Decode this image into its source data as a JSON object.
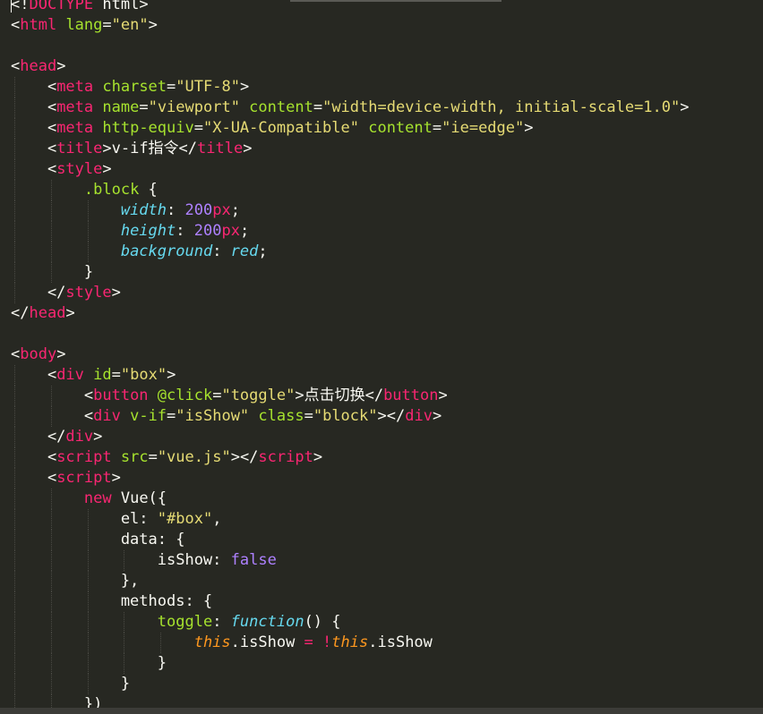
{
  "editor": {
    "lines": [
      [
        {
          "t": "<!",
          "c": "plain"
        },
        {
          "t": "DOCTYPE",
          "c": "tag"
        },
        {
          "t": " html>",
          "c": "plain"
        }
      ],
      [
        {
          "t": "<",
          "c": "plain"
        },
        {
          "t": "html",
          "c": "tag"
        },
        {
          "t": " lang",
          "c": "attr"
        },
        {
          "t": "=",
          "c": "plain"
        },
        {
          "t": "\"en\"",
          "c": "str"
        },
        {
          "t": ">",
          "c": "plain"
        }
      ],
      [],
      [
        {
          "t": "<",
          "c": "plain"
        },
        {
          "t": "head",
          "c": "tag"
        },
        {
          "t": ">",
          "c": "plain"
        }
      ],
      [
        {
          "t": "    <",
          "c": "plain"
        },
        {
          "t": "meta",
          "c": "tag"
        },
        {
          "t": " charset",
          "c": "attr"
        },
        {
          "t": "=",
          "c": "plain"
        },
        {
          "t": "\"UTF-8\"",
          "c": "str"
        },
        {
          "t": ">",
          "c": "plain"
        }
      ],
      [
        {
          "t": "    <",
          "c": "plain"
        },
        {
          "t": "meta",
          "c": "tag"
        },
        {
          "t": " name",
          "c": "attr"
        },
        {
          "t": "=",
          "c": "plain"
        },
        {
          "t": "\"viewport\"",
          "c": "str"
        },
        {
          "t": " content",
          "c": "attr"
        },
        {
          "t": "=",
          "c": "plain"
        },
        {
          "t": "\"width=device-width, initial-scale=1.0\"",
          "c": "str"
        },
        {
          "t": ">",
          "c": "plain"
        }
      ],
      [
        {
          "t": "    <",
          "c": "plain"
        },
        {
          "t": "meta",
          "c": "tag"
        },
        {
          "t": " http-equiv",
          "c": "attr"
        },
        {
          "t": "=",
          "c": "plain"
        },
        {
          "t": "\"X-UA-Compatible\"",
          "c": "str"
        },
        {
          "t": " content",
          "c": "attr"
        },
        {
          "t": "=",
          "c": "plain"
        },
        {
          "t": "\"ie=edge\"",
          "c": "str"
        },
        {
          "t": ">",
          "c": "plain"
        }
      ],
      [
        {
          "t": "    <",
          "c": "plain"
        },
        {
          "t": "title",
          "c": "tag"
        },
        {
          "t": ">v-if指令</",
          "c": "plain"
        },
        {
          "t": "title",
          "c": "tag"
        },
        {
          "t": ">",
          "c": "plain"
        }
      ],
      [
        {
          "t": "    <",
          "c": "plain"
        },
        {
          "t": "style",
          "c": "tag"
        },
        {
          "t": ">",
          "c": "plain"
        }
      ],
      [
        {
          "t": "        ",
          "c": "plain"
        },
        {
          "t": ".block",
          "c": "attr"
        },
        {
          "t": " {",
          "c": "plain"
        }
      ],
      [
        {
          "t": "            ",
          "c": "plain"
        },
        {
          "t": "width",
          "c": "prop"
        },
        {
          "t": ": ",
          "c": "plain"
        },
        {
          "t": "200",
          "c": "num"
        },
        {
          "t": "px",
          "c": "kw"
        },
        {
          "t": ";",
          "c": "plain"
        }
      ],
      [
        {
          "t": "            ",
          "c": "plain"
        },
        {
          "t": "height",
          "c": "prop"
        },
        {
          "t": ": ",
          "c": "plain"
        },
        {
          "t": "200",
          "c": "num"
        },
        {
          "t": "px",
          "c": "kw"
        },
        {
          "t": ";",
          "c": "plain"
        }
      ],
      [
        {
          "t": "            ",
          "c": "plain"
        },
        {
          "t": "background",
          "c": "prop"
        },
        {
          "t": ": ",
          "c": "plain"
        },
        {
          "t": "red",
          "c": "func"
        },
        {
          "t": ";",
          "c": "plain"
        }
      ],
      [
        {
          "t": "        }",
          "c": "plain"
        }
      ],
      [
        {
          "t": "    </",
          "c": "plain"
        },
        {
          "t": "style",
          "c": "tag"
        },
        {
          "t": ">",
          "c": "plain"
        }
      ],
      [
        {
          "t": "</",
          "c": "plain"
        },
        {
          "t": "head",
          "c": "tag"
        },
        {
          "t": ">",
          "c": "plain"
        }
      ],
      [],
      [
        {
          "t": "<",
          "c": "plain"
        },
        {
          "t": "body",
          "c": "tag"
        },
        {
          "t": ">",
          "c": "plain"
        }
      ],
      [
        {
          "t": "    <",
          "c": "plain"
        },
        {
          "t": "div",
          "c": "tag"
        },
        {
          "t": " id",
          "c": "attr"
        },
        {
          "t": "=",
          "c": "plain"
        },
        {
          "t": "\"box\"",
          "c": "str"
        },
        {
          "t": ">",
          "c": "plain"
        }
      ],
      [
        {
          "t": "        <",
          "c": "plain"
        },
        {
          "t": "button",
          "c": "tag"
        },
        {
          "t": " @click",
          "c": "attr"
        },
        {
          "t": "=",
          "c": "plain"
        },
        {
          "t": "\"toggle\"",
          "c": "str"
        },
        {
          "t": ">点击切换</",
          "c": "plain"
        },
        {
          "t": "button",
          "c": "tag"
        },
        {
          "t": ">",
          "c": "plain"
        }
      ],
      [
        {
          "t": "        <",
          "c": "plain"
        },
        {
          "t": "div",
          "c": "tag"
        },
        {
          "t": " v-if",
          "c": "attr"
        },
        {
          "t": "=",
          "c": "plain"
        },
        {
          "t": "\"isShow\"",
          "c": "str"
        },
        {
          "t": " class",
          "c": "attr"
        },
        {
          "t": "=",
          "c": "plain"
        },
        {
          "t": "\"block\"",
          "c": "str"
        },
        {
          "t": "></",
          "c": "plain"
        },
        {
          "t": "div",
          "c": "tag"
        },
        {
          "t": ">",
          "c": "plain"
        }
      ],
      [
        {
          "t": "    </",
          "c": "plain"
        },
        {
          "t": "div",
          "c": "tag"
        },
        {
          "t": ">",
          "c": "plain"
        }
      ],
      [
        {
          "t": "    <",
          "c": "plain"
        },
        {
          "t": "script",
          "c": "tag"
        },
        {
          "t": " src",
          "c": "attr"
        },
        {
          "t": "=",
          "c": "plain"
        },
        {
          "t": "\"vue.js\"",
          "c": "str"
        },
        {
          "t": "></",
          "c": "plain"
        },
        {
          "t": "script",
          "c": "tag"
        },
        {
          "t": ">",
          "c": "plain"
        }
      ],
      [
        {
          "t": "    <",
          "c": "plain"
        },
        {
          "t": "script",
          "c": "tag"
        },
        {
          "t": ">",
          "c": "plain"
        }
      ],
      [
        {
          "t": "        ",
          "c": "plain"
        },
        {
          "t": "new",
          "c": "kw"
        },
        {
          "t": " Vue({",
          "c": "plain"
        }
      ],
      [
        {
          "t": "            el: ",
          "c": "plain"
        },
        {
          "t": "\"#box\"",
          "c": "str"
        },
        {
          "t": ",",
          "c": "plain"
        }
      ],
      [
        {
          "t": "            data: {",
          "c": "plain"
        }
      ],
      [
        {
          "t": "                isShow: ",
          "c": "plain"
        },
        {
          "t": "false",
          "c": "bool"
        }
      ],
      [
        {
          "t": "            },",
          "c": "plain"
        }
      ],
      [
        {
          "t": "            methods: {",
          "c": "plain"
        }
      ],
      [
        {
          "t": "                ",
          "c": "plain"
        },
        {
          "t": "toggle",
          "c": "fn"
        },
        {
          "t": ": ",
          "c": "plain"
        },
        {
          "t": "function",
          "c": "func"
        },
        {
          "t": "() {",
          "c": "plain"
        }
      ],
      [
        {
          "t": "                    ",
          "c": "plain"
        },
        {
          "t": "this",
          "c": "this"
        },
        {
          "t": ".isShow ",
          "c": "plain"
        },
        {
          "t": "=",
          "c": "kw"
        },
        {
          "t": " ",
          "c": "plain"
        },
        {
          "t": "!",
          "c": "kw"
        },
        {
          "t": "this",
          "c": "this"
        },
        {
          "t": ".isShow",
          "c": "plain"
        }
      ],
      [
        {
          "t": "                }",
          "c": "plain"
        }
      ],
      [
        {
          "t": "            }",
          "c": "plain"
        }
      ],
      [
        {
          "t": "        })",
          "c": "plain"
        }
      ]
    ],
    "guides": [
      [],
      [],
      [],
      [],
      [
        1
      ],
      [
        1
      ],
      [
        1
      ],
      [
        1
      ],
      [
        1
      ],
      [
        1,
        2
      ],
      [
        1,
        2,
        3
      ],
      [
        1,
        2,
        3
      ],
      [
        1,
        2,
        3
      ],
      [
        1,
        2
      ],
      [
        1
      ],
      [],
      [],
      [],
      [
        1
      ],
      [
        1,
        2
      ],
      [
        1,
        2
      ],
      [
        1
      ],
      [
        1
      ],
      [
        1
      ],
      [
        1,
        2
      ],
      [
        1,
        2,
        3
      ],
      [
        1,
        2,
        3
      ],
      [
        1,
        2,
        3,
        4
      ],
      [
        1,
        2,
        3
      ],
      [
        1,
        2,
        3
      ],
      [
        1,
        2,
        3,
        4
      ],
      [
        1,
        2,
        3,
        4,
        5
      ],
      [
        1,
        2,
        3,
        4
      ],
      [
        1,
        2,
        3
      ],
      [
        1,
        2
      ]
    ]
  }
}
